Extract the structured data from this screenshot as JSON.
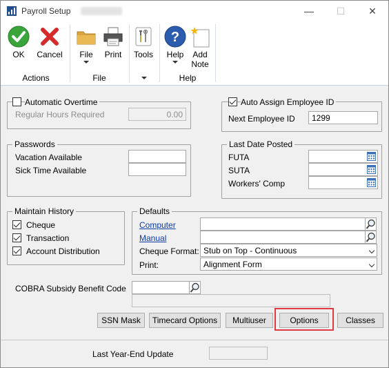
{
  "window": {
    "title": "Payroll Setup",
    "minimize": "—",
    "maximize": "☐",
    "close": "✕"
  },
  "ribbon": {
    "ok": "OK",
    "cancel": "Cancel",
    "file": "File",
    "print": "Print",
    "tools": "Tools",
    "help": "Help",
    "add_note_line1": "Add",
    "add_note_line2": "Note",
    "group_actions": "Actions",
    "group_file": "File",
    "group_help": "Help"
  },
  "overtime": {
    "checkbox_label": "Automatic Overtime",
    "checked": false,
    "regular_hours_label": "Regular Hours Required",
    "regular_hours_value": "0.00"
  },
  "employee_id": {
    "checkbox_label": "Auto Assign Employee ID",
    "checked": true,
    "next_label": "Next Employee ID",
    "next_value": "1299"
  },
  "passwords": {
    "title": "Passwords",
    "vacation_label": "Vacation Available",
    "sick_label": "Sick Time Available"
  },
  "last_date_posted": {
    "title": "Last Date Posted",
    "futa": "FUTA",
    "suta": "SUTA",
    "workers_comp": "Workers' Comp"
  },
  "maintain_history": {
    "title": "Maintain History",
    "cheque": "Cheque",
    "transaction": "Transaction",
    "account_distribution": "Account Distribution"
  },
  "defaults": {
    "title": "Defaults",
    "computer": "Computer",
    "manual": "Manual",
    "cheque_format_label": "Cheque Format:",
    "cheque_format_value": "Stub on Top - Continuous",
    "print_label": "Print:",
    "print_value": "Alignment Form"
  },
  "cobra": {
    "label": "COBRA Subsidy Benefit Code"
  },
  "buttons": {
    "ssn_mask": "SSN Mask",
    "timecard_options": "Timecard Options",
    "multiuser": "Multiuser",
    "options": "Options",
    "classes": "Classes"
  },
  "footer": {
    "last_year_end_label": "Last Year-End Update"
  },
  "colors": {
    "highlight": "#e0393e",
    "link": "#0b3aa8"
  }
}
